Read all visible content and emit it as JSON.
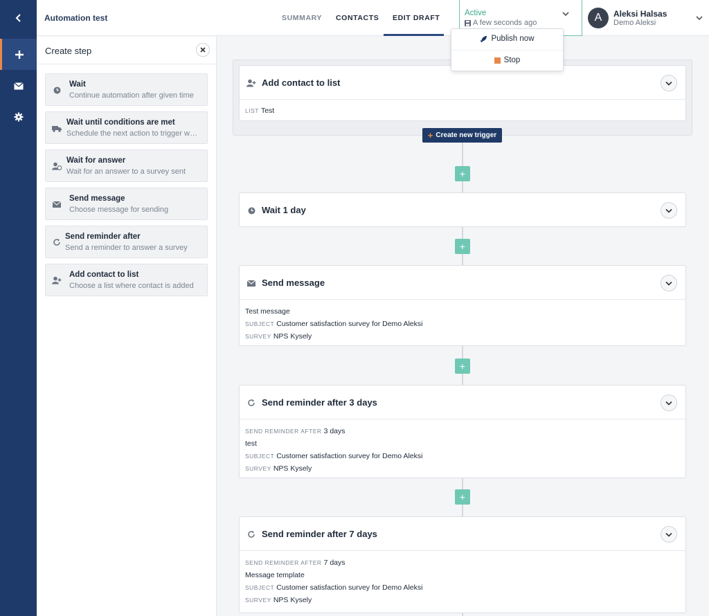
{
  "header": {
    "app_title": "Automation test",
    "tabs": [
      "SUMMARY",
      "CONTACTS",
      "EDIT DRAFT"
    ],
    "status": {
      "label": "Active",
      "time": "A few seconds ago"
    },
    "user": {
      "initial": "A",
      "name": "Aleksi Halsas",
      "org": "Demo Aleksi"
    }
  },
  "dropdown": {
    "publish": "Publish now",
    "stop": "Stop"
  },
  "panel": {
    "title": "Create step",
    "steps": [
      {
        "title": "Wait",
        "desc": "Continue automation after given time"
      },
      {
        "title": "Wait until conditions are met",
        "desc": "Schedule the next action to trigger when"
      },
      {
        "title": "Wait for answer",
        "desc": "Wait for an answer to a survey sent"
      },
      {
        "title": "Send message",
        "desc": "Choose message for sending"
      },
      {
        "title": "Send reminder after",
        "desc": "Send a reminder to answer a survey"
      },
      {
        "title": "Add contact to list",
        "desc": "Choose a list where contact is added"
      }
    ]
  },
  "flow": {
    "trigger_button": "Create new trigger",
    "trigger": {
      "title": "Add contact to list",
      "list_key": "LIST",
      "list_val": "Test"
    },
    "wait": {
      "title": "Wait 1 day"
    },
    "send": {
      "title": "Send message",
      "name": "Test message",
      "subject_key": "SUBJECT",
      "subject_val": "Customer satisfaction survey for Demo Aleksi",
      "survey_key": "SURVEY",
      "survey_val": "NPS Kysely"
    },
    "reminder3": {
      "title": "Send reminder after 3 days",
      "after_key": "SEND REMINDER AFTER",
      "after_val": "3 days",
      "name": "test",
      "subject_key": "SUBJECT",
      "subject_val": "Customer satisfaction survey for Demo Aleksi",
      "survey_key": "SURVEY",
      "survey_val": "NPS Kysely"
    },
    "reminder7": {
      "title": "Send reminder after 7 days",
      "after_key": "SEND REMINDER AFTER",
      "after_val": "7 days",
      "name": "Message template",
      "subject_key": "SUBJECT",
      "subject_val": "Customer satisfaction survey for Demo Aleksi",
      "survey_key": "SURVEY",
      "survey_val": "NPS Kysely"
    }
  }
}
